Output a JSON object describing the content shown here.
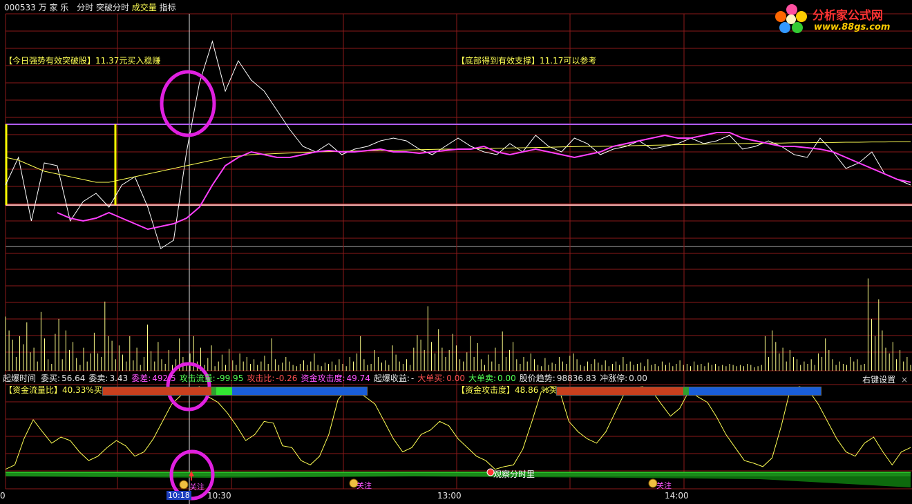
{
  "header": {
    "code": "000533",
    "name": "万 家 乐",
    "menu": [
      "分时",
      "突破分时",
      "成交量",
      "指标"
    ],
    "menu_colors": [
      "#e6e6e6",
      "#e6e6e6",
      "#ffff54",
      "#e6e6e6"
    ]
  },
  "logo": {
    "title": "分析家公式网",
    "url": "www.88gs.com"
  },
  "annotations": {
    "left": {
      "bracket": "【今日强势有效突破股】",
      "text": "11.37元买入稳赚"
    },
    "right": {
      "bracket": "【底部得到有效支撑】",
      "text": "11.17可以参考"
    }
  },
  "stats_bar": [
    {
      "label": "起爆时间",
      "value": "",
      "label_color": "#e6e6e6",
      "value_color": "#e6e6e6"
    },
    {
      "label": "委买:",
      "value": "56.64",
      "label_color": "#e6e6e6",
      "value_color": "#e6e6e6"
    },
    {
      "label": "委卖:",
      "value": "3.43",
      "label_color": "#e6e6e6",
      "value_color": "#e6e6e6"
    },
    {
      "label": "委差:",
      "value": "492.5",
      "label_color": "#ff54ff",
      "value_color": "#ff54ff"
    },
    {
      "label": "攻击流量:",
      "value": "-99.95",
      "label_color": "#54ff54",
      "value_color": "#54ff54"
    },
    {
      "label": "攻击比:",
      "value": "-0.26",
      "label_color": "#ff5050",
      "value_color": "#ff5050"
    },
    {
      "label": "资金攻击度:",
      "value": "49.74",
      "label_color": "#ff54ff",
      "value_color": "#ff54ff"
    },
    {
      "label": "起爆收益:",
      "value": "-",
      "label_color": "#e6e6e6",
      "value_color": "#e6e6e6"
    },
    {
      "label": "大单买:",
      "value": "0.00",
      "label_color": "#ff5050",
      "value_color": "#ff5050"
    },
    {
      "label": "大单卖:",
      "value": "0.00",
      "label_color": "#54ff54",
      "value_color": "#54ff54"
    },
    {
      "label": "股价趋势:",
      "value": "98836.83",
      "label_color": "#e6e6e6",
      "value_color": "#e6e6e6"
    },
    {
      "label": "冲涨停:",
      "value": "0.00",
      "label_color": "#e6e6e6",
      "value_color": "#e6e6e6"
    }
  ],
  "settings_label": "右键设置",
  "close_glyph": "×",
  "indicators": {
    "left": {
      "label": "【资金流量比】",
      "value": "40.33%买",
      "bar": [
        0.41,
        0.02,
        0.06,
        0.51
      ]
    },
    "right": {
      "label": "【资金攻击度】",
      "value": "48.86 %买",
      "bar": [
        0.48,
        0.02,
        0.0,
        0.5
      ]
    }
  },
  "bar_colors": [
    "#c8401e",
    "#2ea02e",
    "#33e633",
    "#1a5ed8"
  ],
  "signals": {
    "marker_label": "关注",
    "text_marker": "观察分时里"
  },
  "time_axis": {
    "left_value": "0",
    "badge": "10:18",
    "ticks": [
      "10:30",
      "13:00",
      "14:00"
    ]
  },
  "chart_data": [
    {
      "type": "line",
      "panel": "price",
      "series": [
        {
          "name": "",
          "color": "#ffffff",
          "values": [
            10.98,
            11.08,
            10.85,
            11.06,
            11.05,
            10.85,
            10.92,
            10.95,
            10.9,
            10.98,
            11.01,
            10.9,
            10.75,
            10.78,
            11.1,
            11.35,
            11.5,
            11.32,
            11.43,
            11.36,
            11.32,
            11.25,
            11.18,
            11.12,
            11.1,
            11.13,
            11.09,
            11.11,
            11.12,
            11.14,
            11.15,
            11.14,
            11.11,
            11.09,
            11.12,
            11.15,
            11.12,
            11.1,
            11.09,
            11.13,
            11.1,
            11.16,
            11.12,
            11.1,
            11.15,
            11.13,
            11.09,
            11.11,
            11.12,
            11.14,
            11.11,
            11.12,
            11.13,
            11.15,
            11.13,
            11.14,
            11.16,
            11.11,
            11.12,
            11.14,
            11.12,
            11.09,
            11.08,
            11.15,
            11.1,
            11.04,
            11.06,
            11.1,
            11.02,
            11.0,
            10.98
          ]
        },
        {
          "name": "",
          "color": "#ffff54",
          "values": [
            11.08,
            11.07,
            11.05,
            11.03,
            11.02,
            11.01,
            11.0,
            10.99,
            10.99,
            11.0,
            11.01,
            11.02,
            11.03,
            11.04,
            11.05,
            11.06,
            11.07,
            11.08,
            11.085,
            11.09,
            11.092,
            11.094,
            11.096,
            11.098,
            11.1,
            11.101,
            11.102,
            11.103,
            11.104,
            11.105,
            11.106,
            11.107,
            11.108,
            11.109,
            11.11,
            11.11,
            11.111,
            11.112,
            11.113,
            11.114,
            11.115,
            11.116,
            11.117,
            11.118,
            11.119,
            11.12,
            11.12,
            11.121,
            11.122,
            11.123,
            11.124,
            11.125,
            11.126,
            11.127,
            11.128,
            11.129,
            11.13,
            11.13,
            11.131,
            11.132,
            11.132,
            11.133,
            11.133,
            11.134,
            11.134,
            11.135,
            11.135,
            11.136,
            11.136,
            11.137,
            11.137
          ]
        },
        {
          "name": "",
          "color": "#ff40ff",
          "values": [
            null,
            null,
            null,
            null,
            10.88,
            10.86,
            10.85,
            10.86,
            10.88,
            10.86,
            10.84,
            10.82,
            10.83,
            10.84,
            10.86,
            10.9,
            10.98,
            11.05,
            11.08,
            11.1,
            11.09,
            11.08,
            11.08,
            11.09,
            11.1,
            11.105,
            11.1,
            11.1,
            11.105,
            11.11,
            11.1,
            11.1,
            11.095,
            11.1,
            11.105,
            11.11,
            11.11,
            11.12,
            11.1,
            11.09,
            11.1,
            11.11,
            11.1,
            11.09,
            11.08,
            11.09,
            11.1,
            11.12,
            11.13,
            11.14,
            11.15,
            11.16,
            11.15,
            11.15,
            11.16,
            11.17,
            11.17,
            11.15,
            11.14,
            11.13,
            11.12,
            11.12,
            11.115,
            11.11,
            11.1,
            11.08,
            11.06,
            11.04,
            11.02,
            11.0,
            10.99
          ]
        }
      ],
      "ylim": [
        10.8,
        11.6
      ]
    },
    {
      "type": "bar",
      "panel": "volume",
      "values": [
        0.47,
        0.35,
        0.27,
        0.12,
        0.3,
        0.23,
        0.42,
        0.16,
        0.2,
        0.08,
        0.51,
        0.28,
        0.1,
        0.06,
        0.32,
        0.45,
        0.1,
        0.35,
        0.18,
        0.25,
        0.11,
        0.05,
        0.2,
        0.08,
        0.15,
        0.33,
        0.15,
        0.12,
        0.6,
        0.3,
        0.26,
        0.1,
        0.22,
        0.14,
        0.08,
        0.3,
        0.09,
        0.2,
        0.05,
        0.12,
        0.4,
        0.17,
        0.08,
        0.25,
        0.1,
        0.06,
        0.18,
        0.05,
        0.1,
        0.28,
        0.12,
        0.06,
        0.15,
        0.3,
        0.08,
        0.2,
        0.05,
        0.11,
        0.22,
        0.04,
        0.08,
        0.14,
        0.05,
        0.19,
        0.09,
        0.05,
        0.15,
        0.08,
        0.12,
        0.06,
        0.1,
        0.05,
        0.08,
        0.13,
        0.06,
        0.28,
        0.1,
        0.05,
        0.07,
        0.12,
        0.08,
        0.05,
        0.04,
        0.06,
        0.09,
        0.05,
        0.08,
        0.15,
        0.05,
        0.04,
        0.07,
        0.06,
        0.08,
        0.05,
        0.1,
        0.06,
        0.04,
        0.12,
        0.08,
        0.15,
        0.3,
        0.1,
        0.05,
        0.06,
        0.18,
        0.12,
        0.07,
        0.09,
        0.05,
        0.22,
        0.14,
        0.08,
        0.06,
        0.1,
        0.05,
        0.2,
        0.31,
        0.27,
        0.18,
        0.56,
        0.25,
        0.15,
        0.36,
        0.2,
        0.12,
        0.18,
        0.32,
        0.22,
        0.1,
        0.08,
        0.16,
        0.3,
        0.12,
        0.24,
        0.1,
        0.05,
        0.14,
        0.08,
        0.2,
        0.06,
        0.34,
        0.12,
        0.18,
        0.25,
        0.1,
        0.06,
        0.12,
        0.08,
        0.15,
        0.1,
        0.05,
        0.04,
        0.11,
        0.05,
        0.07,
        0.06,
        0.12,
        0.08,
        0.06,
        0.13,
        0.15,
        0.1,
        0.05,
        0.04,
        0.08,
        0.06,
        0.1,
        0.07,
        0.05,
        0.09,
        0.04,
        0.06,
        0.08,
        0.05,
        0.12,
        0.06,
        0.08,
        0.05,
        0.06,
        0.07,
        0.04,
        0.1,
        0.05,
        0.06,
        0.04,
        0.08,
        0.05,
        0.07,
        0.04,
        0.06,
        0.09,
        0.05,
        0.06,
        0.04,
        0.08,
        0.05,
        0.06,
        0.04,
        0.07,
        0.05,
        0.06,
        0.04,
        0.05,
        0.04,
        0.06,
        0.05,
        0.04,
        0.05,
        0.04,
        0.06,
        0.05,
        0.03,
        0.04,
        0.05,
        0.3,
        0.12,
        0.35,
        0.25,
        0.15,
        0.2,
        0.08,
        0.18,
        0.12,
        0.1,
        0.05,
        0.08,
        0.06,
        0.1,
        0.05,
        0.15,
        0.12,
        0.28,
        0.18,
        0.1,
        0.05,
        0.08,
        0.06,
        0.05,
        0.12,
        0.08,
        0.1,
        0.05,
        0.06,
        0.8,
        0.45,
        0.3,
        0.62,
        0.35,
        0.2,
        0.15,
        0.25,
        0.1,
        0.18,
        0.08,
        0.12,
        0.05
      ],
      "ylim": [
        0,
        1
      ]
    },
    {
      "type": "line",
      "panel": "indicator",
      "series": [
        {
          "name": "",
          "color": "#ffff54",
          "values": [
            5,
            10,
            40,
            62,
            48,
            35,
            42,
            38,
            25,
            15,
            20,
            30,
            38,
            32,
            20,
            25,
            40,
            60,
            80,
            90,
            97,
            100,
            88,
            82,
            70,
            55,
            38,
            45,
            60,
            58,
            32,
            30,
            15,
            10,
            20,
            45,
            85,
            98,
            95,
            88,
            80,
            60,
            40,
            25,
            30,
            45,
            50,
            60,
            55,
            40,
            30,
            20,
            15,
            5,
            8,
            10,
            28,
            60,
            94,
            100,
            95,
            60,
            48,
            40,
            35,
            48,
            70,
            92,
            99,
            100,
            95,
            80,
            66,
            75,
            95,
            88,
            82,
            65,
            45,
            30,
            15,
            12,
            8,
            18,
            55,
            98,
            100,
            95,
            80,
            60,
            40,
            25,
            20,
            35,
            42,
            25,
            10,
            25,
            30
          ]
        }
      ],
      "ylim": [
        0,
        100
      ]
    }
  ]
}
